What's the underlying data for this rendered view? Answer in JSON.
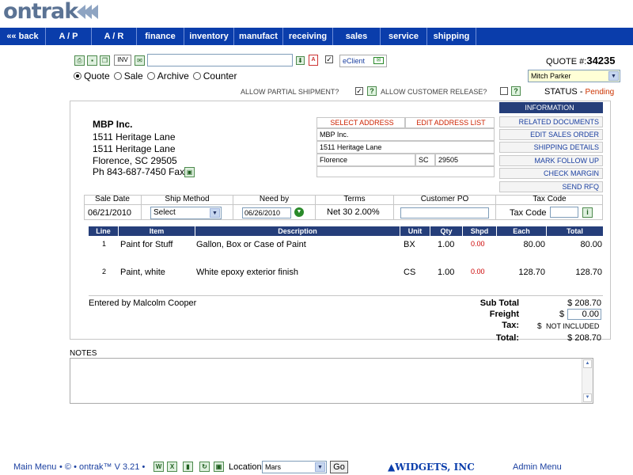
{
  "logo": {
    "text": "ontrak"
  },
  "nav": {
    "items": [
      "«« back",
      "A / P",
      "A / R",
      "finance",
      "inventory",
      "manufact",
      "receiving",
      "sales",
      "service",
      "shipping"
    ]
  },
  "toolbar": {
    "inv_label": "INV",
    "search_value": "",
    "eclient_label": "eClient"
  },
  "quote": {
    "label": "QUOTE #:",
    "number": "34235",
    "user": "Mitch Parker",
    "status_label": "STATUS -",
    "status_value": "Pending",
    "partial_shipment": "ALLOW PARTIAL SHIPMENT?",
    "customer_release": "ALLOW CUSTOMER RELEASE?"
  },
  "modes": [
    "Quote",
    "Sale",
    "Archive",
    "Counter"
  ],
  "customer": {
    "name": "MBP Inc.",
    "address1": "1511 Heritage Lane",
    "address2": "1511 Heritage Lane",
    "city_line": "Florence, SC 29505",
    "phone_line": "Ph 843-687-7450",
    "fax_label": "Fax"
  },
  "address_form": {
    "select_address": "SELECT ADDRESS",
    "edit_address_list": "EDIT ADDRESS LIST",
    "name": "MBP Inc.",
    "street": "1511 Heritage Lane",
    "city": "Florence",
    "state": "SC",
    "zip": "29505"
  },
  "side_buttons": [
    "INFORMATION",
    "RELATED DOCUMENTS",
    "EDIT SALES ORDER",
    "SHIPPING DETAILS",
    "MARK FOLLOW UP",
    "CHECK MARGIN",
    "SEND RFQ"
  ],
  "order_header": {
    "sale_date_label": "Sale Date",
    "sale_date": "06/21/2010",
    "ship_method_label": "Ship Method",
    "ship_method": "Select",
    "need_by_label": "Need by",
    "need_by": "06/26/2010",
    "terms_label": "Terms",
    "terms": "Net 30 2.00%",
    "customer_po_label": "Customer PO",
    "customer_po": "",
    "tax_code_label": "Tax Code",
    "tax_code_field_label": "Tax Code",
    "tax_code": ""
  },
  "items_table": {
    "headers": [
      "Line",
      "Item",
      "Description",
      "Unit",
      "Qty",
      "Shpd",
      "Each",
      "Total"
    ],
    "rows": [
      {
        "line": "1",
        "item": "Paint for Stuff",
        "description": "Gallon, Box or Case of Paint",
        "unit": "BX",
        "qty": "1.00",
        "shpd": "0.00",
        "each": "80.00",
        "total": "80.00"
      },
      {
        "line": "2",
        "item": "Paint, white",
        "description": "White epoxy exterior finish",
        "unit": "CS",
        "qty": "1.00",
        "shpd": "0.00",
        "each": "128.70",
        "total": "128.70"
      }
    ]
  },
  "totals": {
    "entered_by": "Entered by Malcolm Cooper",
    "subtotal_label": "Sub Total",
    "subtotal": "$ 208.70",
    "freight_label": "Freight",
    "freight_currency": "$",
    "freight": "0.00",
    "tax_label": "Tax:",
    "tax_currency": "$",
    "tax_value": "NOT INCLUDED",
    "total_label": "Total:",
    "total": "$ 208.70"
  },
  "notes": {
    "label": "NOTES",
    "value": ""
  },
  "footer": {
    "main_menu": "Main Menu",
    "version": "• © • ontrak™ V 3.21 •",
    "location_label": "Location",
    "location_value": "Mars",
    "go_label": "Go",
    "company": "WIDGETS, INC",
    "admin_menu": "Admin Menu"
  },
  "colors": {
    "nav": "#0a3dab",
    "header_bar": "#253e7a",
    "status": "#cc3300",
    "logo": "#5b7394"
  }
}
